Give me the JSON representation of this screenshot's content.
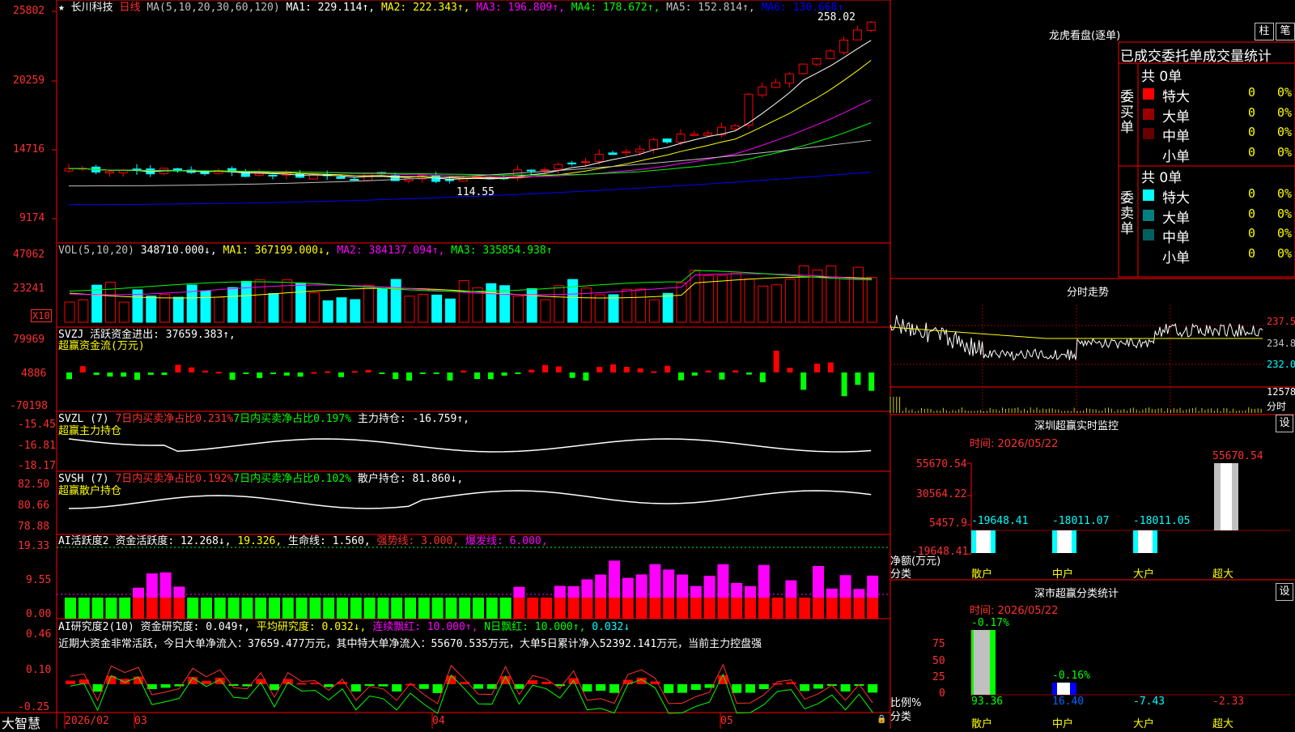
{
  "stock": {
    "name": "长川科技",
    "period": "日线",
    "star": "★"
  },
  "ma_bar": {
    "prefix": "MA(5,10,20,30,60,120)",
    "items": [
      {
        "label": "MA1: 229.114↑,",
        "color": "#ffffff"
      },
      {
        "label": "MA2: 222.343↑,",
        "color": "#ffff00"
      },
      {
        "label": "MA3: 196.809↑,",
        "color": "#ff00ff"
      },
      {
        "label": "MA4: 178.672↑,",
        "color": "#00ff00"
      },
      {
        "label": "MA5: 152.814↑,",
        "color": "#c0c0c0"
      },
      {
        "label": "MA6: 130.668↑",
        "color": "#0000ff"
      }
    ]
  },
  "price_axis": [
    "25802",
    "20259",
    "14716",
    "9174"
  ],
  "price_marks": {
    "high": "258.02",
    "low": "114.55"
  },
  "vol": {
    "prefix": "VOL(5,10,20)",
    "value": "348710.000↓,",
    "ma1": "MA1: 367199.000↓,",
    "ma2": "MA2: 384137.094↑,",
    "ma3": "MA3: 335854.938↑",
    "axis": [
      "47062",
      "23241"
    ],
    "unit": "X10"
  },
  "svzj": {
    "prefix": "SVZJ  活跃资金进出: 37659.383↑,",
    "sub": "超赢资金流(万元)",
    "axis": [
      "79969",
      "4886",
      "-70198"
    ]
  },
  "svzl": {
    "prefix": "SVZL (7)",
    "a": "7日内买卖净占比0.231%",
    "b": "7日内买卖净占比0.197%",
    "c": "主力持仓: -16.759↑,",
    "sub": "超赢主力持仓",
    "axis": [
      "-15.45",
      "-16.81",
      "-18.17"
    ]
  },
  "svsh": {
    "prefix": "SVSH (7)",
    "a": "7日内买卖净占比0.192%",
    "b": "7日内买卖净占比0.102%",
    "c": "散户持仓: 81.860↓,",
    "sub": "超赢散户持仓",
    "axis": [
      "82.50",
      "80.66",
      "78.88"
    ]
  },
  "ai_active": {
    "prefix": "AI活跃度2",
    "a": "资金活跃度: 12.268↓,",
    "b": "19.326,",
    "c": "生命线: 1.560,",
    "d": "强势线: 3.000,",
    "e": "爆发线: 6.000,",
    "axis": [
      "19.33",
      "9.55",
      "0.00"
    ]
  },
  "ai_research": {
    "prefix": "AI研究度2(10)",
    "a": "资金研究度: 0.049↑,",
    "b": "平均研究度: 0.032↓,",
    "c": "连续飘红: 10.000↑,",
    "d": "N日飘红: 10.000↑,",
    "e": "0.032↓",
    "summary": "近期大资金非常活跃，今日大单净流入：37659.477万元，其中特大单净流入：55670.535万元，大单5日累计净入52392.141万元，当前主力控盘强",
    "axis": [
      "0.46",
      "0.10",
      "-0.25"
    ]
  },
  "bottom_axis": {
    "brand": "大智慧",
    "labels": [
      "2026/02",
      "03",
      "04",
      "05"
    ]
  },
  "dragon": {
    "title": "龙虎看盘(逐单)",
    "btn_zhu": "柱",
    "btn_bi": "笔",
    "header": "已成交委托单成交量统计",
    "buy_label": "委买单",
    "sell_label": "委卖单",
    "buy_total": "共 0单",
    "sell_total": "共 0单",
    "buy_rows": [
      {
        "label": "特大",
        "count": "0",
        "pct": "0%",
        "color": "#ff0000"
      },
      {
        "label": "大单",
        "count": "0",
        "pct": "0%",
        "color": "#990000"
      },
      {
        "label": "中单",
        "count": "0",
        "pct": "0%",
        "color": "#660000"
      },
      {
        "label": "小单",
        "count": "0",
        "pct": "0%",
        "color": "#000000"
      }
    ],
    "sell_rows": [
      {
        "label": "特大",
        "count": "0",
        "pct": "0%",
        "color": "#00ffff"
      },
      {
        "label": "大单",
        "count": "0",
        "pct": "0%",
        "color": "#008080"
      },
      {
        "label": "中单",
        "count": "0",
        "pct": "0%",
        "color": "#006060"
      },
      {
        "label": "小单",
        "count": "0",
        "pct": "0%",
        "color": "#000000"
      }
    ]
  },
  "intraday": {
    "title": "分时走势",
    "axis": [
      "237.5",
      "234.8",
      "232.0"
    ],
    "vol_axis": "12578",
    "vol_label": "分时"
  },
  "monitor": {
    "title": "深圳超赢实时监控",
    "btn": "设",
    "time": "时间: 2026/05/22",
    "axis": [
      "55670.54",
      "30564.22",
      "5457.9",
      "-19648.41"
    ],
    "ylabel_1": "净额(万元)",
    "ylabel_2": "分类",
    "categories": [
      "散户",
      "中户",
      "大户",
      "超大"
    ],
    "values": [
      "-19648.41",
      "-18011.07",
      "-18011.05",
      "55670.54"
    ]
  },
  "classify": {
    "title": "深市超赢分类统计",
    "btn": "设",
    "time": "时间: 2026/05/22",
    "axis": [
      "75",
      "50",
      "25",
      "0"
    ],
    "ylabel_1": "比例%",
    "ylabel_2": "分类",
    "categories": [
      "散户",
      "中户",
      "大户",
      "超大"
    ],
    "values": [
      "93.36",
      "16.40",
      "-7.43",
      "-2.33"
    ],
    "top_labels": [
      "-0.17%",
      "-0.16%"
    ]
  },
  "chart_data": {
    "type": "candlestick",
    "ylim": [
      91.74,
      258.02
    ],
    "x_labels": [
      "2026/02",
      "03",
      "04",
      "05"
    ],
    "high": 258.02,
    "low": 114.55,
    "ma": {
      "MA1": 229.114,
      "MA2": 222.343,
      "MA3": 196.809,
      "MA4": 178.672,
      "MA5": 152.814,
      "MA6": 130.668
    }
  }
}
